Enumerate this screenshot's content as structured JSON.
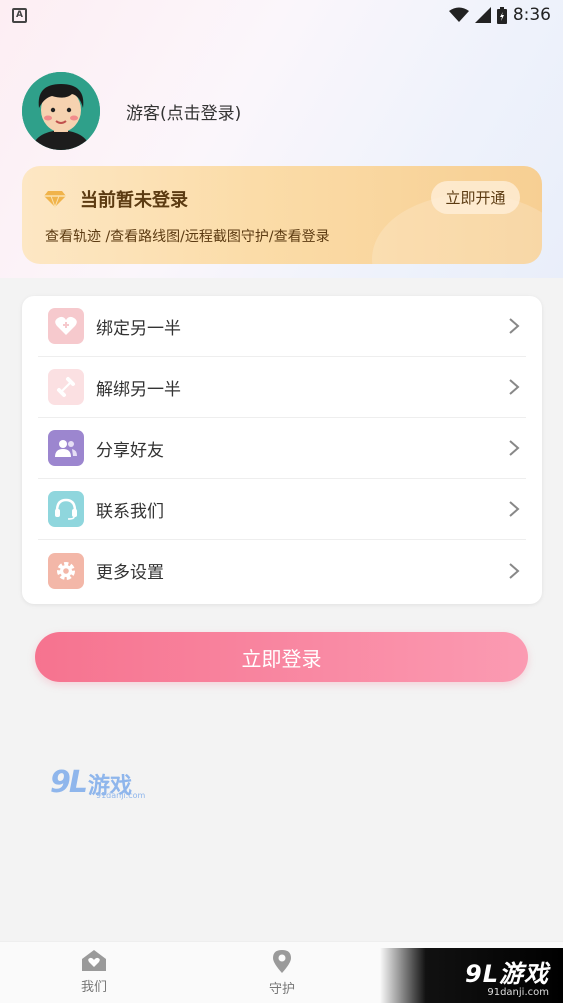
{
  "status_bar": {
    "left_icon": "A",
    "time": "8:36"
  },
  "profile": {
    "name": "游客(点击登录)"
  },
  "vip": {
    "title": "当前暂未登录",
    "description": "查看轨迹 /查看路线图/远程截图守护/查看登录",
    "button": "立即开通"
  },
  "menu": {
    "items": [
      {
        "label": "绑定另一半",
        "icon": "heart-bind-icon",
        "color": "#f6c9cd"
      },
      {
        "label": "解绑另一半",
        "icon": "unlink-icon",
        "color": "#fbe0e2"
      },
      {
        "label": "分享好友",
        "icon": "users-icon",
        "color": "#9c86cf"
      },
      {
        "label": "联系我们",
        "icon": "headset-icon",
        "color": "#8fd6dd"
      },
      {
        "label": "更多设置",
        "icon": "gear-icon",
        "color": "#f3b7a8"
      }
    ]
  },
  "login_button": "立即登录",
  "watermark": {
    "big": "9L",
    "cn": "游戏",
    "url": "91danji.com"
  },
  "tabs": [
    {
      "label": "我们",
      "icon": "home-heart-icon"
    },
    {
      "label": "守护",
      "icon": "location-pin-icon"
    }
  ],
  "corner_logo": {
    "main": "9L游戏",
    "url": "91danji.com"
  },
  "colors": {
    "accent": "#f6738f",
    "vip_text": "#5c3b12"
  }
}
